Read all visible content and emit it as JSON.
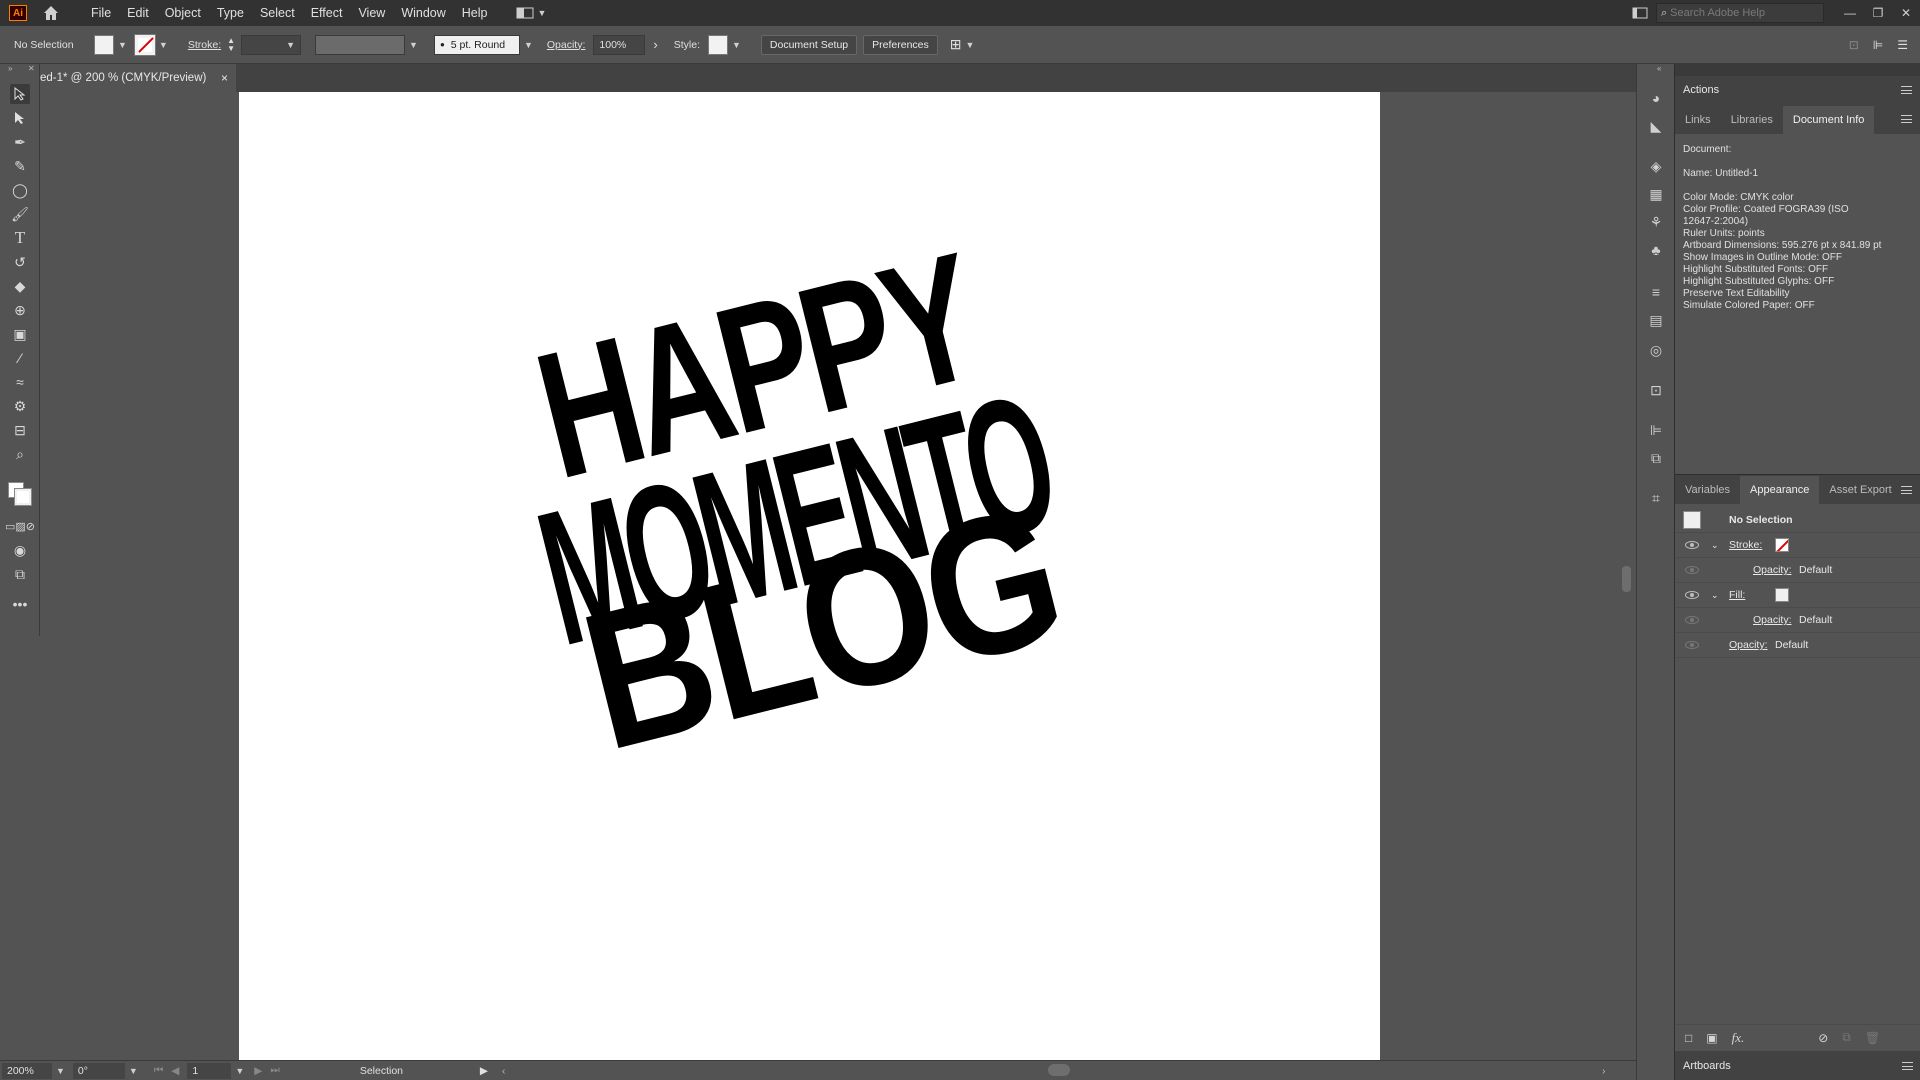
{
  "app": {
    "logo": "Ai"
  },
  "menu": [
    "File",
    "Edit",
    "Object",
    "Type",
    "Select",
    "Effect",
    "View",
    "Window",
    "Help"
  ],
  "search": {
    "placeholder": "Search Adobe Help"
  },
  "control_bar": {
    "selection": "No Selection",
    "stroke_label": "Stroke:",
    "brush": "5 pt. Round",
    "opacity_label": "Opacity:",
    "opacity_value": "100%",
    "style_label": "Style:",
    "doc_setup": "Document Setup",
    "preferences": "Preferences"
  },
  "doc_tab": {
    "title": "ed-1* @ 200 % (CMYK/Preview)",
    "close": "×"
  },
  "artwork": {
    "line1": "HAPPY",
    "line2": "MOMENTO",
    "line3": "BLOG"
  },
  "panels": {
    "actions": "Actions",
    "tabs_top": [
      "Links",
      "Libraries",
      "Document Info"
    ],
    "docinfo": {
      "heading": "Document:",
      "name": "Name: Untitled-1",
      "lines": [
        "Color Mode: CMYK color",
        "Color Profile: Coated FOGRA39 (ISO",
        "12647-2:2004)",
        "Ruler Units: points",
        "Artboard Dimensions: 595.276 pt x 841.89 pt",
        "Show Images in Outline Mode: OFF",
        "Highlight Substituted Fonts: OFF",
        "Highlight Substituted Glyphs: OFF",
        "Preserve Text Editability",
        "Simulate Colored Paper: OFF"
      ]
    },
    "tabs_bottom": [
      "Variables",
      "Appearance",
      "Asset Export"
    ],
    "appearance": {
      "title": "No Selection",
      "stroke": "Stroke:",
      "opacity_label": "Opacity:",
      "opacity_value": "Default",
      "fill": "Fill:"
    },
    "fx": "fx.",
    "artboards": "Artboards"
  },
  "status": {
    "zoom": "200%",
    "rotation": "0°",
    "artboard": "1",
    "tool": "Selection"
  }
}
